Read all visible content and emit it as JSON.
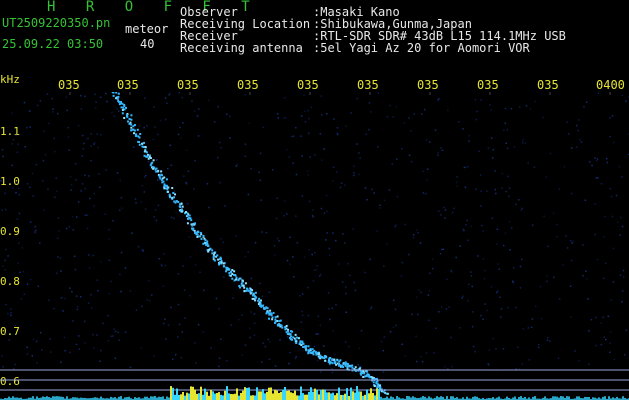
{
  "header": {
    "app_title": "H R O F F T",
    "filename": "UT2509220350.pn",
    "mode_label": "meteor",
    "datetime": "25.09.22 03:50",
    "mode_value": "40",
    "info": [
      {
        "label": "Observer",
        "value": ":Masaki Kano"
      },
      {
        "label": "Receiving Location",
        "value": ":Shibukawa,Gunma,Japan"
      },
      {
        "label": "Receiver",
        "value": ":RTL-SDR SDR# 43dB L15 114.1MHz USB"
      },
      {
        "label": "Receiving antenna",
        "value": ":5el Yagi Az 20 for Aomori VOR"
      }
    ]
  },
  "axes": {
    "freq_unit": "kHz",
    "time_ticks": [
      "035",
      "035",
      "035",
      "035",
      "035",
      "035",
      "035",
      "035",
      "035",
      "0400"
    ],
    "freq_ticks": [
      "1.1",
      "1.0",
      "0.9",
      "0.8",
      "0.7",
      "0.6"
    ]
  },
  "colors": {
    "background": "#000000",
    "header_green": "#35c235",
    "header_white": "#e8e8e8",
    "axis_yellow": "#e6e632",
    "noise_blue": "#1a3a9a",
    "trace_cyan": "#35b8ff",
    "reference_line": "#9aa6d8"
  }
}
